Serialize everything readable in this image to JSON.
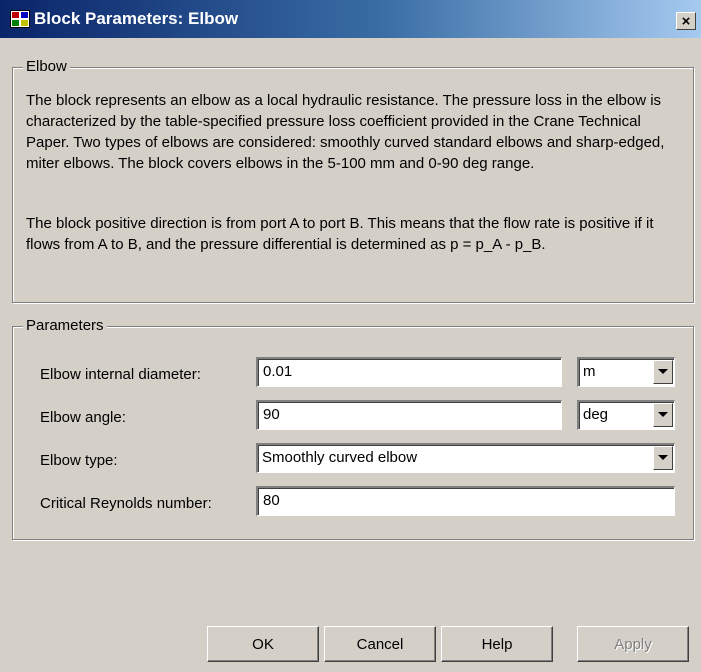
{
  "window": {
    "title": "Block Parameters: Elbow",
    "close_glyph": "×"
  },
  "description_group": {
    "legend": "Elbow",
    "paragraph1": "The block represents an elbow as a local hydraulic resistance. The pressure loss in the elbow is characterized by the table-specified pressure loss coefficient provided in the Crane Technical Paper. Two types of elbows are considered: smoothly curved standard elbows and sharp-edged, miter elbows. The block covers elbows in the 5-100 mm and 0-90 deg range.",
    "paragraph2": "The block positive direction is from port A to port B. This means that the flow rate is positive if it flows from A to B, and the pressure differential is determined as p = p_A - p_B."
  },
  "parameters_group": {
    "legend": "Parameters",
    "rows": [
      {
        "label": "Elbow internal diameter:",
        "value": "0.01",
        "unit": "m"
      },
      {
        "label": "Elbow angle:",
        "value": "90",
        "unit": "deg"
      },
      {
        "label": "Elbow type:",
        "value": "Smoothly curved elbow"
      },
      {
        "label": "Critical Reynolds number:",
        "value": "80"
      }
    ]
  },
  "buttons": {
    "ok": "OK",
    "cancel": "Cancel",
    "help": "Help",
    "apply": "Apply"
  },
  "icons": {
    "app": "simulink-block-icon",
    "dropdown": "dropdown-arrow-icon"
  },
  "colors": {
    "titlebar_start": "#0a246a",
    "titlebar_end": "#a6caf0",
    "window_bg": "#d4d0c8"
  }
}
